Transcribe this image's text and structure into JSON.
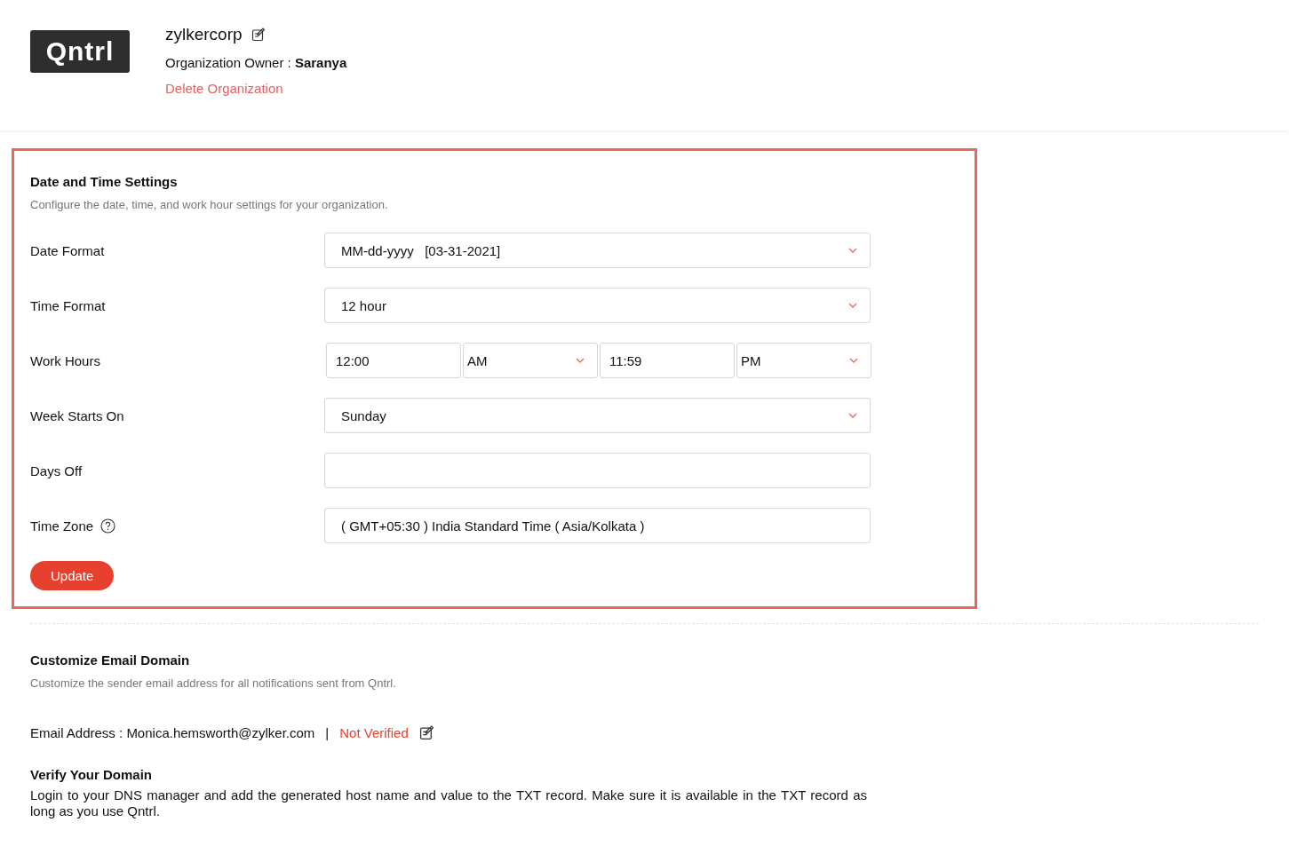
{
  "header": {
    "logo": "Qntrl",
    "org_name": "zylkercorp",
    "owner_label": "Organization Owner : ",
    "owner_name": "Saranya",
    "delete_link": "Delete Organization"
  },
  "date_time": {
    "title": "Date and Time Settings",
    "description": "Configure the date, time, and work hour settings for your organization.",
    "highlighted": true,
    "rows": [
      {
        "kind": "select",
        "label": "Date Format",
        "value": "MM-dd-yyyy   [03-31-2021]"
      },
      {
        "kind": "select",
        "label": "Time Format",
        "value": "12 hour"
      },
      {
        "kind": "time_range",
        "label": "Work Hours",
        "start": "12:00",
        "start_period": "AM",
        "end": "11:59",
        "end_period": "PM"
      },
      {
        "kind": "select",
        "label": "Week Starts On",
        "value": "Sunday"
      },
      {
        "kind": "text",
        "label": "Days Off"
      },
      {
        "kind": "text",
        "label": "Time Zone",
        "help": true,
        "value": "( GMT+05:30 ) India Standard Time ( Asia/Kolkata )"
      }
    ],
    "button": "Update"
  },
  "email_domain": {
    "title": "Customize Email Domain",
    "description": "Customize the sender email address for all notifications sent from Qntrl.",
    "email_label": "Email Address : Monica.hemsworth@zylker.com",
    "separator": "|",
    "status": "Not Verified",
    "verify_title": "Verify Your Domain",
    "verify_text": "Login to your DNS manager and add the generated host name and value to the TXT record. Make sure it is available in the TXT record as long as you use Qntrl."
  }
}
